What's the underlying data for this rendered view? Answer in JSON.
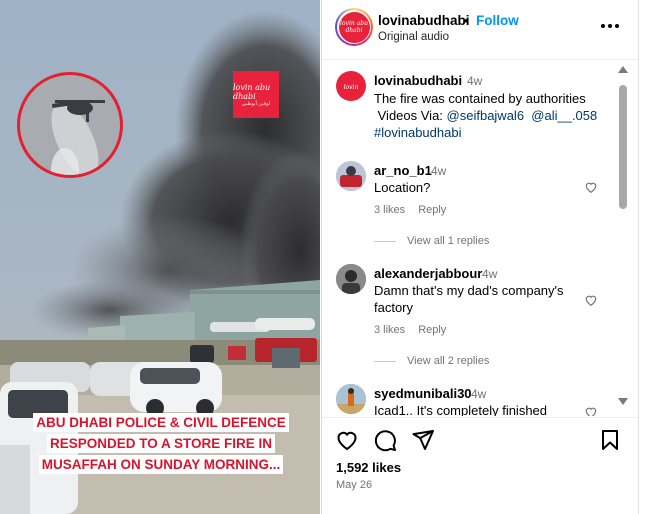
{
  "media": {
    "logo_line1": "lovin abu dhabi",
    "logo_line2": "لوفين أبوظبي",
    "caption_lines": [
      "ABU DHABI POLICE & CIVIL DEFENCE",
      "RESPONDED TO A STORE FIRE IN",
      "MUSAFFAH ON SUNDAY MORNING..."
    ],
    "avatar_text": "lovin abu dhabi"
  },
  "header": {
    "username": "lovinabudhabi",
    "separator": "•",
    "follow_label": "Follow",
    "audio": "Original audio"
  },
  "caption": {
    "username": "lovinabudhabi",
    "time": "4w",
    "line1": "The fire was contained by authorities",
    "line2_prefix": "Videos Via: ",
    "mention1": "@seifbajwal6",
    "mention2": "@ali__.058",
    "hashtag": "#lovinabudhabi"
  },
  "comments": [
    {
      "username": "ar_no_b1",
      "time": "4w",
      "text": "Location?",
      "likes": "3 likes",
      "reply": "Reply",
      "view_replies": "View all 1 replies"
    },
    {
      "username": "alexanderjabbour",
      "time": "4w",
      "text": "Damn that's my dad's company's factory",
      "likes": "3 likes",
      "reply": "Reply",
      "view_replies": "View all 2 replies"
    },
    {
      "username": "syedmunibali30",
      "time": "4w",
      "text": "Icad1.. It's completely finished"
    }
  ],
  "footer": {
    "likes": "1,592 likes",
    "date": "May 26"
  },
  "colors": {
    "follow": "#0095f6",
    "brand_red": "#e8223b",
    "caption_red": "#d8142c",
    "link": "#00376b",
    "muted": "#737373"
  }
}
